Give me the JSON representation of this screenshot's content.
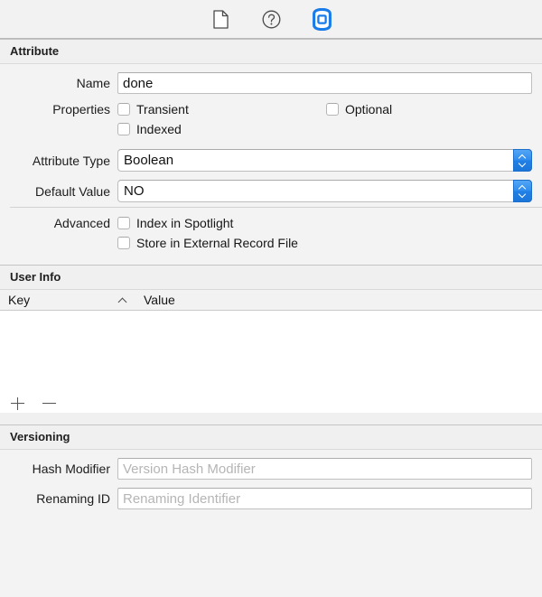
{
  "toolbar": {
    "buttons": [
      {
        "name": "file-inspector",
        "icon": "document-icon",
        "selected": false
      },
      {
        "name": "quick-help-inspector",
        "icon": "question-circle-icon",
        "selected": false
      },
      {
        "name": "data-model-inspector",
        "icon": "data-model-icon",
        "selected": true
      }
    ],
    "accent_color": "#2f8ced"
  },
  "attribute": {
    "section_title": "Attribute",
    "name_label": "Name",
    "name_value": "done",
    "properties_label": "Properties",
    "transient_label": "Transient",
    "transient_checked": false,
    "optional_label": "Optional",
    "optional_checked": false,
    "indexed_label": "Indexed",
    "indexed_checked": false,
    "attribute_type_label": "Attribute Type",
    "attribute_type_value": "Boolean",
    "default_value_label": "Default Value",
    "default_value_value": "NO",
    "advanced_label": "Advanced",
    "index_spotlight_label": "Index in Spotlight",
    "index_spotlight_checked": false,
    "store_external_label": "Store in External Record File",
    "store_external_checked": false
  },
  "user_info": {
    "section_title": "User Info",
    "columns": [
      "Key",
      "Value"
    ],
    "sort_column": "Key",
    "sort_direction": "ascending",
    "rows": [],
    "add_button_label": "+",
    "remove_button_label": "−"
  },
  "versioning": {
    "section_title": "Versioning",
    "hash_modifier_label": "Hash Modifier",
    "hash_modifier_value": "",
    "hash_modifier_placeholder": "Version Hash Modifier",
    "renaming_id_label": "Renaming ID",
    "renaming_id_value": "",
    "renaming_id_placeholder": "Renaming Identifier"
  }
}
